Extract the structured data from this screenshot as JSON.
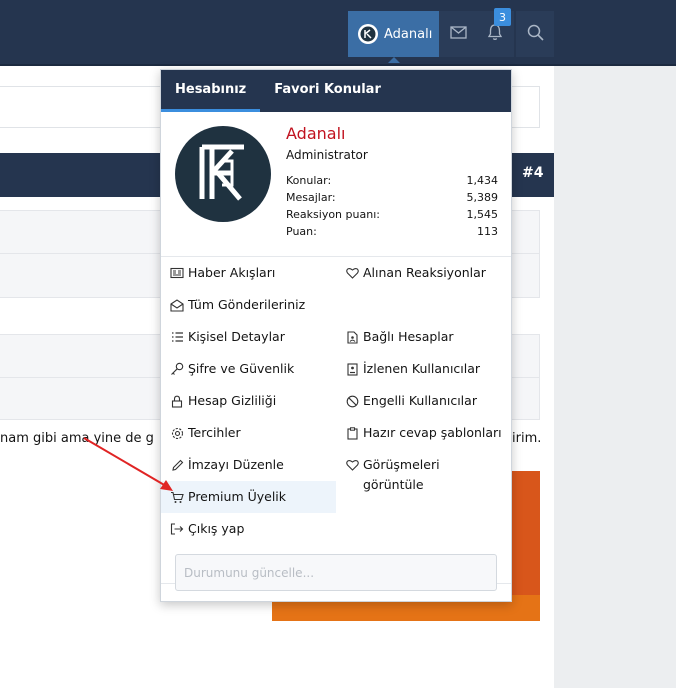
{
  "header": {
    "username": "Adanalı",
    "notification_count": "3",
    "icons": [
      "avatar-icon",
      "envelope-icon",
      "bell-icon",
      "search-icon"
    ]
  },
  "post": {
    "number": "#4",
    "text_left": "nam gibi ama yine de g",
    "text_right": "irim."
  },
  "menu": {
    "tabs": [
      "Hesabınız",
      "Favori Konular"
    ],
    "profile": {
      "name": "Adanalı",
      "role": "Administrator",
      "stats": [
        {
          "label": "Konular:",
          "value": "1,434"
        },
        {
          "label": "Mesajlar:",
          "value": "5,389"
        },
        {
          "label": "Reaksiyon puanı:",
          "value": "1,545"
        },
        {
          "label": "Puan:",
          "value": "113"
        }
      ]
    },
    "left_links": [
      {
        "label": "Haber Akışları",
        "icon": "newspaper-icon"
      },
      {
        "label": "Tüm Gönderileriniz",
        "icon": "envelope-open-icon"
      },
      {
        "label": "Kişisel Detaylar",
        "icon": "list-icon"
      },
      {
        "label": "Şifre ve Güvenlik",
        "icon": "key-icon"
      },
      {
        "label": "Hesap Gizliliği",
        "icon": "lock-icon"
      },
      {
        "label": "Tercihler",
        "icon": "gear-icon"
      },
      {
        "label": "İmzayı Düzenle",
        "icon": "pen-icon"
      },
      {
        "label": "Premium Üyelik",
        "icon": "cart-icon"
      },
      {
        "label": "Çıkış yap",
        "icon": "sign-out-icon"
      }
    ],
    "right_links": [
      {
        "label": "Alınan Reaksiyonlar",
        "icon": "heart-icon"
      },
      {
        "label": "Bağlı Hesaplar",
        "icon": "file-user-icon"
      },
      {
        "label": "İzlenen Kullanıcılar",
        "icon": "id-badge-icon"
      },
      {
        "label": "Engelli Kullanıcılar",
        "icon": "ban-icon"
      },
      {
        "label": "Hazır cevap şablonları",
        "icon": "clipboard-icon"
      },
      {
        "label": "Görüşmeleri görüntüle",
        "icon": "heart-outline-icon"
      }
    ],
    "status_placeholder": "Durumunu güncelle..."
  },
  "colors": {
    "header_bg": "#25354f",
    "user_button": "#3b6ea5",
    "badge": "#3b8ede",
    "name_red": "#c1121f",
    "annotation_arrow": "#e02424"
  }
}
